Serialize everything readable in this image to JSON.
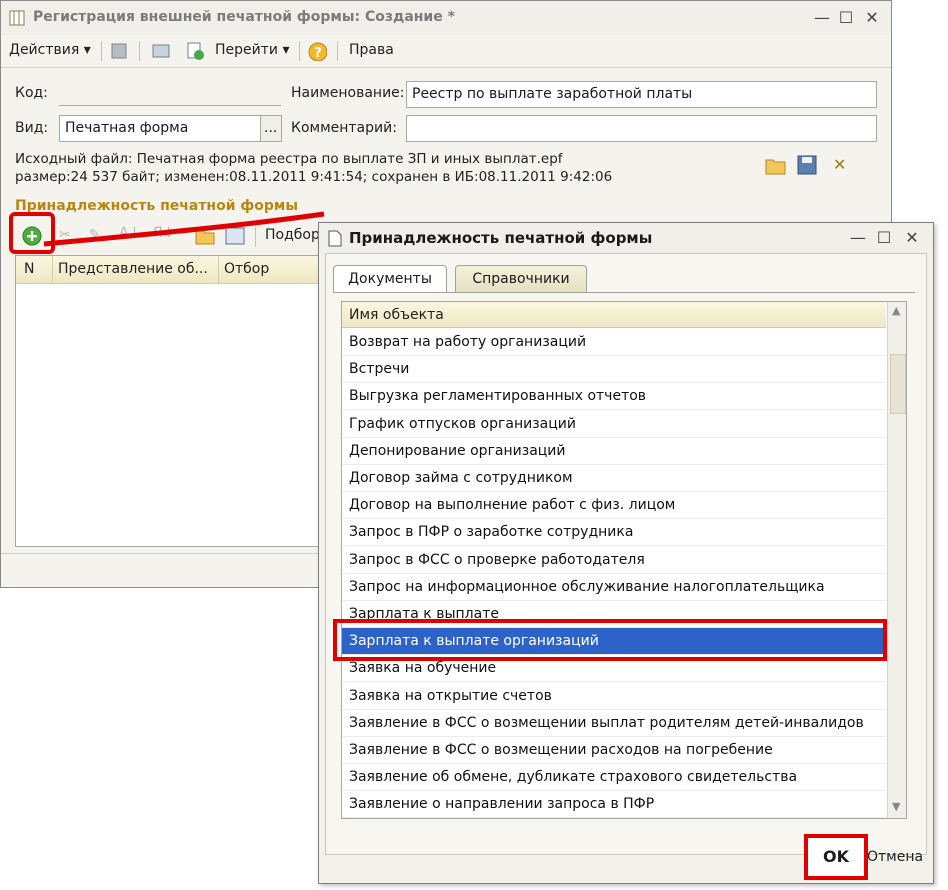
{
  "main_window": {
    "title": "Регистрация внешней печатной формы: Создание *",
    "toolbar": {
      "actions": "Действия",
      "goto": "Перейти",
      "rights": "Права"
    },
    "form": {
      "code_label": "Код:",
      "code_value": "",
      "name_label": "Наименование:",
      "name_value": "Реестр по выплате заработной платы",
      "kind_label": "Вид:",
      "kind_value": "Печатная форма",
      "kind_button": "...",
      "comment_label": "Комментарий:",
      "comment_value": ""
    },
    "source_file": "Исходный файл: Печатная форма реестра по выплате ЗП и иных выплат.epf",
    "file_meta": "размер:24 537 байт; изменен:08.11.2011 9:41:54; сохранен в ИБ:08.11.2011 9:42:06",
    "section_title": "Принадлежность печатной формы",
    "section_toolbar_pick": "Подбор",
    "table_columns": [
      "N",
      "Представление об...",
      "Отбор"
    ]
  },
  "dialog": {
    "title": "Принадлежность печатной формы",
    "tabs": [
      {
        "label": "Документы",
        "active": true
      },
      {
        "label": "Справочники",
        "active": false
      }
    ],
    "list_header": "Имя объекта",
    "items": [
      "Возврат на работу организаций",
      "Встречи",
      "Выгрузка регламентированных отчетов",
      "График отпусков организаций",
      "Депонирование организаций",
      "Договор займа с сотрудником",
      "Договор на выполнение работ с физ. лицом",
      "Запрос в ПФР о заработке сотрудника",
      "Запрос в ФСС о проверке работодателя",
      "Запрос на информационное обслуживание налогоплательщика",
      "Зарплата к выплате",
      "Зарплата к выплате организаций",
      "Заявка на обучение",
      "Заявка на открытие счетов",
      "Заявление в ФСС о возмещении выплат родителям детей-инвалидов",
      "Заявление в ФСС о возмещении расходов на погребение",
      "Заявление об обмене, дубликате страхового свидетельства",
      "Заявление о направлении запроса в ПФР"
    ],
    "selected_index": 11,
    "ok_label": "OK",
    "cancel_label": "Отмена"
  },
  "colors": {
    "selection": "#2d63c8",
    "highlight_annotation": "#e00000",
    "section_title": "#b8870f"
  }
}
